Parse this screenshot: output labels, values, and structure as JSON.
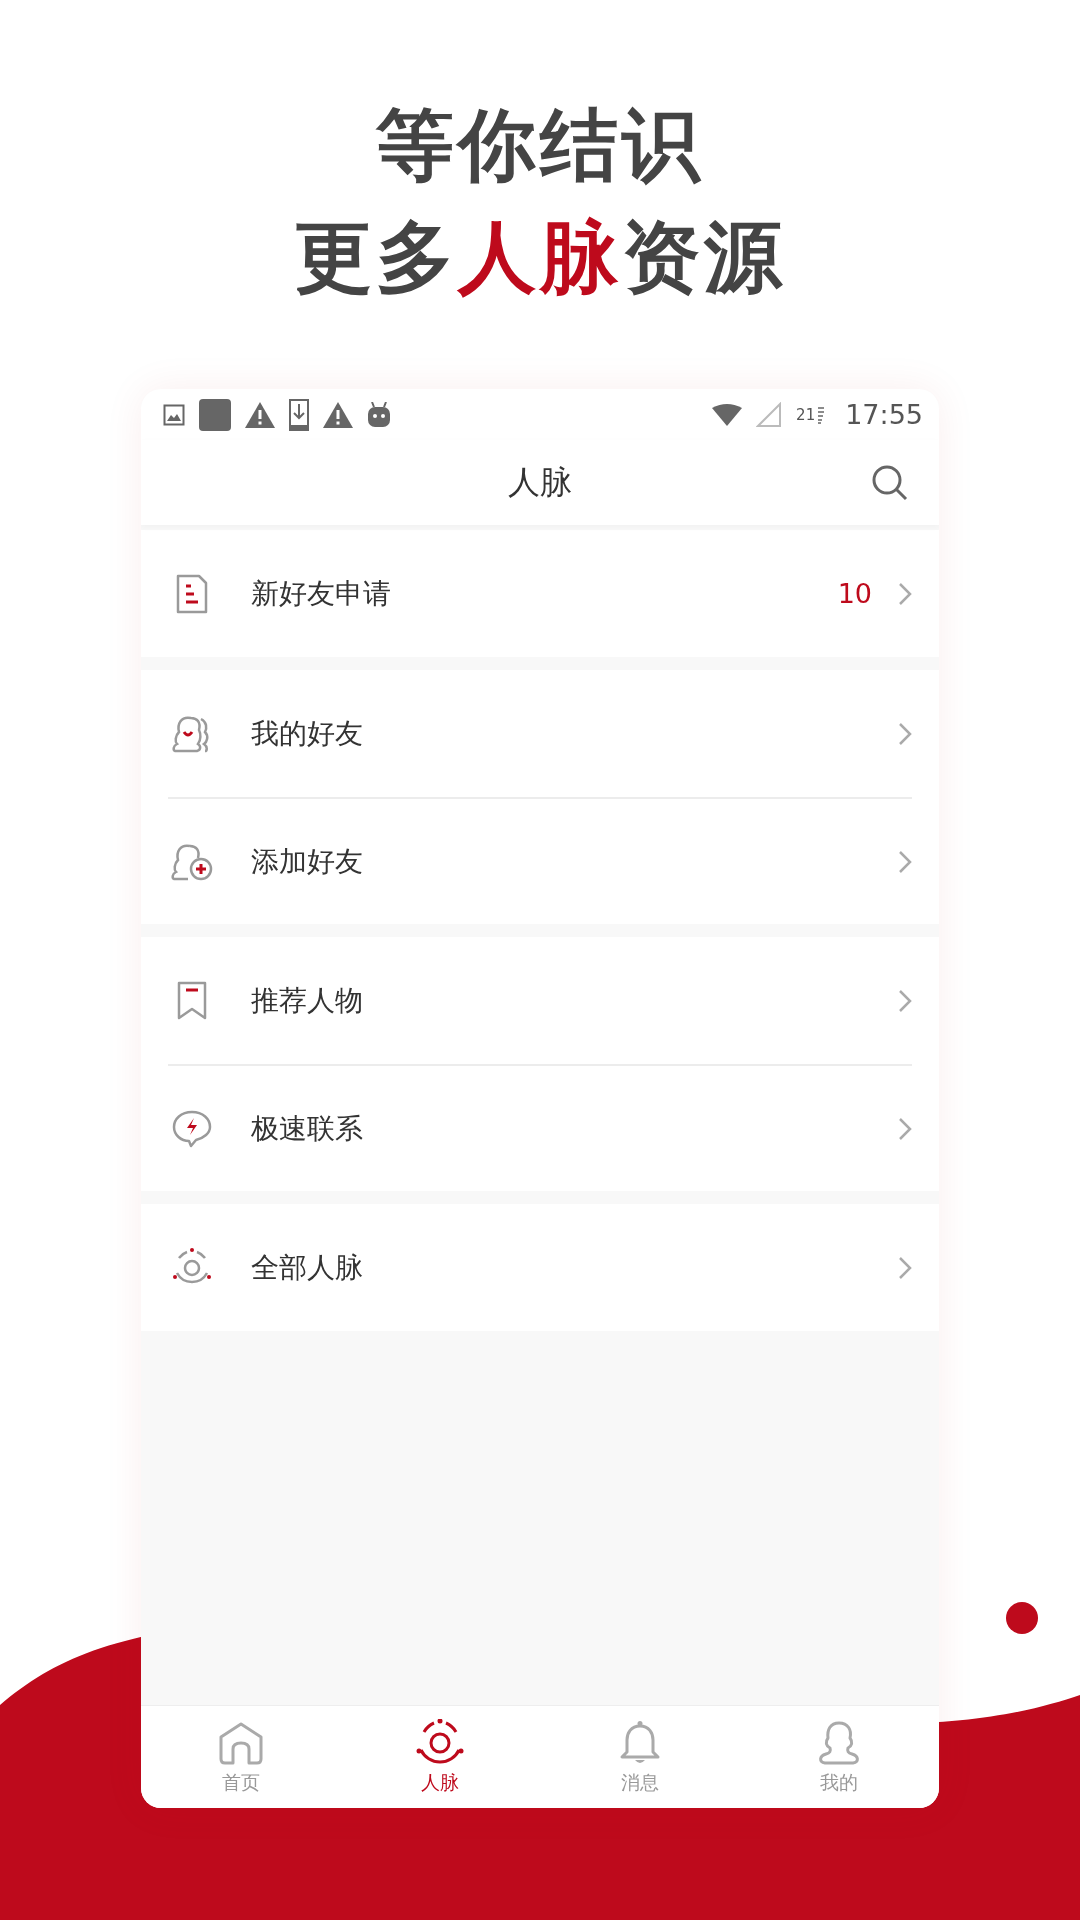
{
  "headline": {
    "line_1": "等你结识",
    "line_2": [
      {
        "text": "更多",
        "highlight": false
      },
      {
        "text": "人脉",
        "highlight": true
      },
      {
        "text": "资源",
        "highlight": false
      }
    ]
  },
  "status_bar": {
    "notifications": [
      {
        "kind": "image"
      },
      {
        "kind": "app"
      },
      {
        "kind": "warning"
      },
      {
        "kind": "download"
      },
      {
        "kind": "warning"
      },
      {
        "kind": "android"
      }
    ],
    "battery": "21",
    "time": "17:55"
  },
  "app_bar": {
    "title": "人脉"
  },
  "groups": [
    {
      "items": [
        {
          "kind": "request",
          "label": "新好友申请",
          "badge": "10"
        }
      ]
    },
    {
      "items": [
        {
          "kind": "friends",
          "label": "我的好友"
        },
        {
          "kind": "add-friend",
          "label": "添加好友"
        }
      ]
    },
    {
      "items": [
        {
          "kind": "recommend",
          "label": "推荐人物"
        },
        {
          "kind": "quick-contact",
          "label": "极速联系"
        }
      ]
    },
    {
      "items": [
        {
          "kind": "all-contacts",
          "label": "全部人脉"
        }
      ]
    }
  ],
  "bottom_nav": [
    {
      "kind": "home",
      "label": "首页",
      "selected": false
    },
    {
      "kind": "contacts",
      "label": "人脉",
      "selected": true
    },
    {
      "kind": "messages",
      "label": "消息",
      "selected": false
    },
    {
      "kind": "profile",
      "label": "我的",
      "selected": false
    }
  ]
}
